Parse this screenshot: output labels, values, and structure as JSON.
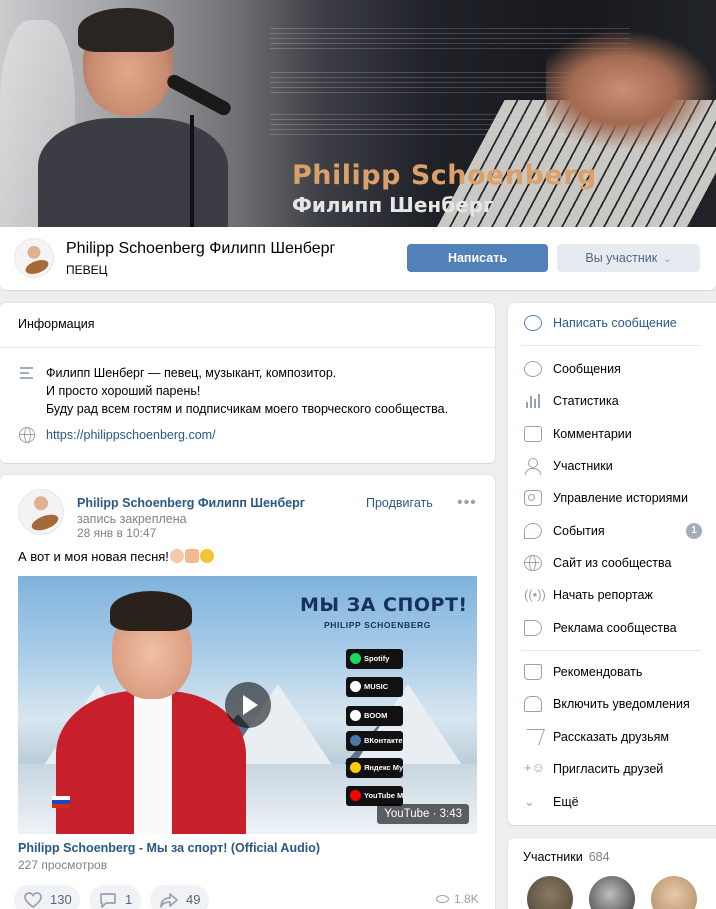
{
  "cover": {
    "title_en": "Philipp Schoenberg",
    "title_ru": "Филипп Шенберг"
  },
  "header": {
    "name": "Philipp Schoenberg Филипп Шенберг",
    "status": "ПЕВЕЦ",
    "write_button": "Написать",
    "member_button": "Вы участник"
  },
  "info": {
    "title": "Информация",
    "description": [
      "Филипп Шенберг — певец, музыкант, композитор.",
      "И просто хороший парень!",
      "Буду рад всем гостям и подписчикам моего творческого сообщества."
    ],
    "site": "https://philippschoenberg.com/"
  },
  "post": {
    "author": "Philipp Schoenberg Филипп Шенберг",
    "action": "запись закреплена",
    "date": "28 янв в 10:47",
    "promote": "Продвигать",
    "more": "•••",
    "text": "А вот и моя новая песня!",
    "video": {
      "poster_title": "МЫ ЗА СПОРТ!",
      "poster_subtitle": "PHILIPP SCHOENBERG",
      "stores": [
        {
          "label": "Spotify",
          "color": "#1ed760"
        },
        {
          "label": "MUSIC",
          "color": "#ffffff"
        },
        {
          "label": "BOOM",
          "color": "#ffffff"
        },
        {
          "label": "ВКонтакте",
          "color": "#4a76a8"
        },
        {
          "label": "Яндекс Музыке",
          "color": "#ffcc00"
        },
        {
          "label": "YouTube Music",
          "color": "#ff0000"
        }
      ],
      "duration": "YouTube · 3:43",
      "title": "Philipp Schoenberg - Мы за спорт! (Official Audio)",
      "views": "227 просмотров"
    },
    "likes": "130",
    "comments": "1",
    "shares": "49",
    "views": "1.8K"
  },
  "menu": {
    "top": {
      "label": "Написать сообщение",
      "icon": "message-bubble-icon"
    },
    "items": [
      {
        "label": "Сообщения",
        "icon": "messages-icon"
      },
      {
        "label": "Статистика",
        "icon": "statistics-icon"
      },
      {
        "label": "Комментарии",
        "icon": "comments-icon"
      },
      {
        "label": "Участники",
        "icon": "members-icon"
      },
      {
        "label": "Управление историями",
        "icon": "stories-icon"
      },
      {
        "label": "События",
        "icon": "events-icon",
        "badge": "1"
      },
      {
        "label": "Сайт из сообщества",
        "icon": "globe-icon"
      },
      {
        "label": "Начать репортаж",
        "icon": "broadcast-icon"
      },
      {
        "label": "Реклама сообщества",
        "icon": "megaphone-icon"
      }
    ],
    "actions": [
      {
        "label": "Рекомендовать",
        "icon": "thumb-up-icon"
      },
      {
        "label": "Включить уведомления",
        "icon": "bell-icon"
      },
      {
        "label": "Рассказать друзьям",
        "icon": "share-icon"
      },
      {
        "label": "Пригласить друзей",
        "icon": "add-user-icon"
      },
      {
        "label": "Ещё",
        "icon": "chevron-down-icon"
      }
    ]
  },
  "members": {
    "title": "Участники",
    "count": "684"
  }
}
